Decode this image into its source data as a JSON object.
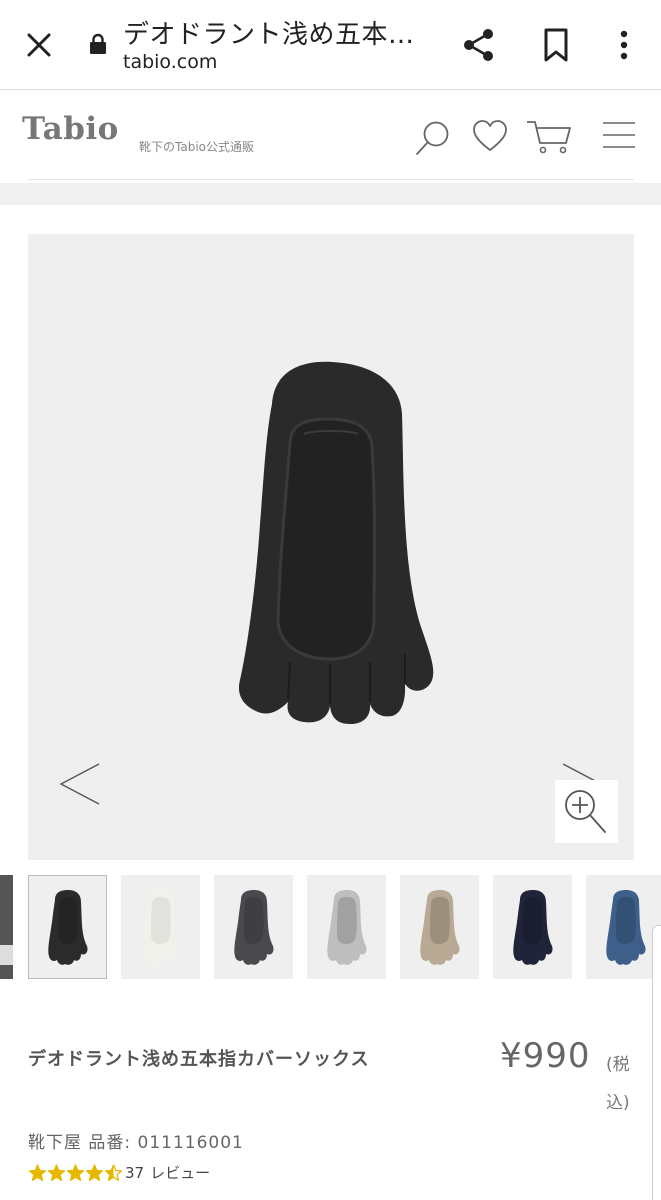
{
  "browser": {
    "title": "デオドラント浅め五本…",
    "url": "tabio.com",
    "icons": [
      "close-icon",
      "lock-icon",
      "share-icon",
      "bookmark-icon",
      "more-vert-icon"
    ]
  },
  "header": {
    "logo": "Tabio",
    "tagline": "靴下のTabio公式通販",
    "icons": [
      "search-icon",
      "heart-icon",
      "cart-icon",
      "menu-icon"
    ]
  },
  "gallery": {
    "icons": [
      "prev-arrow-icon",
      "next-arrow-icon",
      "zoom-in-icon"
    ],
    "main_color": "#2a2a2b",
    "thumbnails": [
      {
        "color": "#2b2b2c",
        "active": true
      },
      {
        "color": "#f1f1ec",
        "active": false
      },
      {
        "color": "#4a4a4e",
        "active": false
      },
      {
        "color": "#bdbebd",
        "active": false
      },
      {
        "color": "#b7a994",
        "active": false
      },
      {
        "color": "#202438",
        "active": false
      },
      {
        "color": "#3d5f8a",
        "active": false
      }
    ]
  },
  "product": {
    "name": "デオドラント浅め五本指カバーソックス",
    "price": "¥990",
    "tax": "(税込)",
    "shop_info": "靴下屋 品番: 011116001",
    "rating_value": 4.5,
    "review_count": "37",
    "review_label": "レビュー",
    "star_color": "#e6b800"
  }
}
